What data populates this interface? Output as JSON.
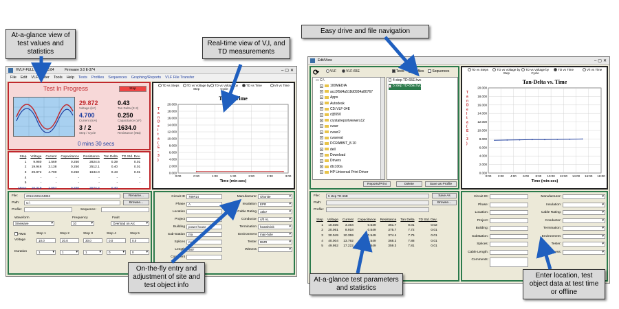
{
  "callouts": {
    "glance_values": "At-a-glance view of test values and statistics",
    "realtime": "Real-time view of V,I, and TD measurements",
    "easy_drive": "Easy drive and file navigation",
    "onthefly": "On-the-fly entry and adjustment of site and test object info",
    "glance_params": "At-a-glance test parameters and statistics",
    "enter_location": "Enter location, test object data at test time or offline"
  },
  "left_window": {
    "title": "HVLF-FULL Version 3.84",
    "title_suffix": "Firmware 3.0 E-374",
    "menu": [
      "File",
      "Edit",
      "VLF Tester",
      "Tools",
      "Help",
      "Tests",
      "Profiles",
      "Sequences",
      "Graphing/Reports",
      "VLF File Transfer"
    ],
    "status_title": "Test In Progress",
    "stop_label": "Stop",
    "readings": [
      {
        "value": "29.872",
        "label": "Voltage (kV)",
        "color": "#c0282d"
      },
      {
        "value": "4.700",
        "label": "Current (mA)",
        "color": "#1f3fa0"
      },
      {
        "value": "3 / 2",
        "label": "Step / Cycle",
        "color": "#000"
      },
      {
        "value": "0.43",
        "label": "Tan Delta (E-3)",
        "color": "#000"
      },
      {
        "value": "0.250",
        "label": "Capacitance (uF)",
        "color": "#000"
      },
      {
        "value": "1634.0",
        "label": "Resistance (MΩ)",
        "color": "#000"
      }
    ],
    "timer": "0 mins 30 secs",
    "table": {
      "headers": [
        "Step",
        "Voltage",
        "Current",
        "Capacitance",
        "Resistance",
        "Tan Delta",
        "TD Std. Dev."
      ],
      "rows": [
        [
          "1",
          "9.980",
          "1.569",
          "0.250",
          "2824.5",
          "0.39",
          "0.01"
        ],
        [
          "2",
          "19.946",
          "3.138",
          "0.250",
          "2512.1",
          "0.40",
          "0.01"
        ],
        [
          "3",
          "29.872",
          "4.700",
          "0.250",
          "1634.0",
          "0.43",
          "0.01"
        ],
        [
          "4",
          "-",
          "-",
          "-",
          "-",
          "-",
          "-"
        ],
        [
          "5",
          "-",
          "-",
          "-",
          "-",
          "-",
          "-"
        ]
      ],
      "mean": [
        "Mean",
        "16.319",
        "2.567",
        "0.250",
        "2574.2",
        "0.40",
        ""
      ],
      "std": [
        "Std. Dev.",
        "6.711",
        "1.056",
        "0.000",
        "464.0",
        "0.01",
        ""
      ]
    },
    "tabs": [
      "TD vs Steps",
      "TD vs Voltage by Step",
      "TD vs Voltage by Cycle",
      "TD vs Time",
      "V/I vs Time"
    ],
    "chart_title": "TD vs. Time",
    "file_label": "File:",
    "file_value": "20161026104853",
    "rename_label": "Rename...",
    "path_label": "Path:",
    "path_value": "C:\\",
    "browse_label": "Browse...",
    "profile_label": "Profile:",
    "sequence_label": "Sequence:",
    "waveform_label": "Waveform",
    "waveform_value": "Sinewave",
    "frequency_label": "Frequency",
    "frequency_value": "10",
    "fault_label": "Fault",
    "fault_value": "Overload on Arc",
    "rms_label": "RMS",
    "voltage_label": "Voltage",
    "duration_label": "Duration",
    "steps": [
      "Step 1",
      "Step 2",
      "Step 3",
      "Step 4",
      "Step 5"
    ],
    "voltages": [
      "10.0",
      "20.0",
      "30.0",
      "0.0",
      "0.0"
    ],
    "durations": [
      "1",
      "1",
      "1",
      "0",
      "0"
    ],
    "site_left": [
      {
        "label": "Circuit ID",
        "value": "789#14"
      },
      {
        "label": "Phase",
        "value": "A"
      },
      {
        "label": "Location",
        "value": ""
      },
      {
        "label": "Project",
        "value": ""
      },
      {
        "label": "Building",
        "value": "power house"
      },
      {
        "label": "Sub-Station",
        "value": "n/a"
      },
      {
        "label": "Splices",
        "value": "none"
      },
      {
        "label": "Length",
        "value": "580'"
      },
      {
        "label": "Comment",
        "value": ""
      }
    ],
    "site_right": [
      {
        "label": "Manufacturer",
        "value": "Okonite"
      },
      {
        "label": "Insulation",
        "value": "EPR"
      },
      {
        "label": "Cable Rating",
        "value": "15kV"
      },
      {
        "label": "Conductor",
        "value": "4/0 AL"
      },
      {
        "label": "Termination",
        "value": "heatshrink"
      },
      {
        "label": "Environment",
        "value": "man-hole"
      },
      {
        "label": "Tester",
        "value": "DMR"
      },
      {
        "label": "Witness",
        "value": ""
      }
    ]
  },
  "right_window": {
    "title": "Edit/View",
    "source_options": [
      "VLF",
      "VLF-65E"
    ],
    "filter_options": [
      "Tests",
      "Profiles",
      "Sequences"
    ],
    "drive": "C:\\",
    "folders": [
      "100MEDIA",
      "acc0f9d4a518d0934a80767",
      "Apps",
      "Autodesk",
      "C2t VLF-34E",
      "clj5550",
      "crystalreportviewers12",
      "cvavr",
      "cvavr2",
      "cvavreal",
      "DCRABBIT_8.10",
      "dell",
      "Download",
      "Drivers",
      "dtx100a",
      "HP Universal Print Driver"
    ],
    "files": [
      "4 step TD-65E.hvc",
      "5 step TD-65E.hvc"
    ],
    "reports_label": "Reports/Print",
    "delete_label": "Delete",
    "save_profile_label": "Save as Profile",
    "tabs": [
      "TD vs Steps",
      "TD vs Voltage by Step",
      "TD vs Voltage by Cycle",
      "TD vs Time",
      "V/I vs Time"
    ],
    "chart_title": "Tan-Delta vs. Time",
    "file_label": "File:",
    "file_value": "5 step TD-65E",
    "save_as_label": "Save As",
    "path_label": "Path:",
    "browse_label": "Browse...",
    "profile_label": "Profile:",
    "table": {
      "headers": [
        "Step",
        "Voltage",
        "Current",
        "Capacitance",
        "Resistance",
        "Tan Delta",
        "TD Std. Dev."
      ],
      "rows": [
        [
          "1",
          "10.035",
          "3.464",
          "0.549",
          "361.7",
          "8.01",
          "0.02"
        ],
        [
          "2",
          "20.061",
          "8.918",
          "0.549",
          "375.7",
          "7.72",
          "0.01"
        ],
        [
          "3",
          "30.049",
          "10.359",
          "0.549",
          "374.4",
          "7.75",
          "0.01"
        ],
        [
          "4",
          "40.004",
          "13.792",
          "0.549",
          "368.2",
          "7.88",
          "0.01"
        ],
        [
          "5",
          "49.952",
          "17.222",
          "0.549",
          "359.3",
          "7.81",
          "0.01"
        ]
      ]
    },
    "site_left": [
      "Circuit ID:",
      "Phase:",
      "Location:",
      "Project:",
      "Building:",
      "Substation:",
      "Splices:",
      "Cable Length:",
      "Comments:"
    ],
    "site_right": [
      "Manufacturer:",
      "Insulation:",
      "Cable Rating:",
      "Conductor:",
      "Termination:",
      "Environment:",
      "Tester:",
      "Witness:"
    ]
  },
  "chart_data": [
    {
      "type": "line",
      "title": "TD vs. Time",
      "xlabel": "Time (min:sec)",
      "ylabel": "Tan Delta (E-3)",
      "xticks": [
        "0:00",
        "0:30",
        "1:00",
        "1:30",
        "2:00",
        "2:30",
        "3:00"
      ],
      "yticks": [
        "0.000",
        "2.000",
        "4.000",
        "6.000",
        "8.000",
        "10.000",
        "12.000",
        "14.000",
        "16.000",
        "18.000",
        "20.000"
      ],
      "xlim": [
        0,
        180
      ],
      "ylim": [
        0,
        20
      ],
      "series": [
        {
          "x": [
            30,
            172
          ],
          "y": [
            0.43,
            0.43
          ],
          "color": "#c0282d"
        }
      ]
    },
    {
      "type": "line",
      "title": "Tan-Delta vs. Time",
      "xlabel": "Time (min:sec)",
      "ylabel": "Tan Delta (E-3)",
      "xticks": [
        "0:00",
        "2:00",
        "4:00",
        "6:00",
        "8:00",
        "10:00",
        "12:00",
        "14:00",
        "16:00",
        "18:00"
      ],
      "yticks": [
        "0.000",
        "2.000",
        "4.000",
        "6.000",
        "8.000",
        "10.000",
        "12.000",
        "14.000",
        "16.000",
        "18.000",
        "20.000"
      ],
      "xlim": [
        0,
        1080
      ],
      "ylim": [
        0,
        20
      ],
      "series": [
        {
          "x": [
            60,
            180,
            300,
            420,
            540,
            660,
            780,
            900
          ],
          "y": [
            7.7,
            7.75,
            7.8,
            7.85,
            7.85,
            7.9,
            7.95,
            8.0
          ],
          "color": "#1f3fa0"
        }
      ]
    }
  ]
}
